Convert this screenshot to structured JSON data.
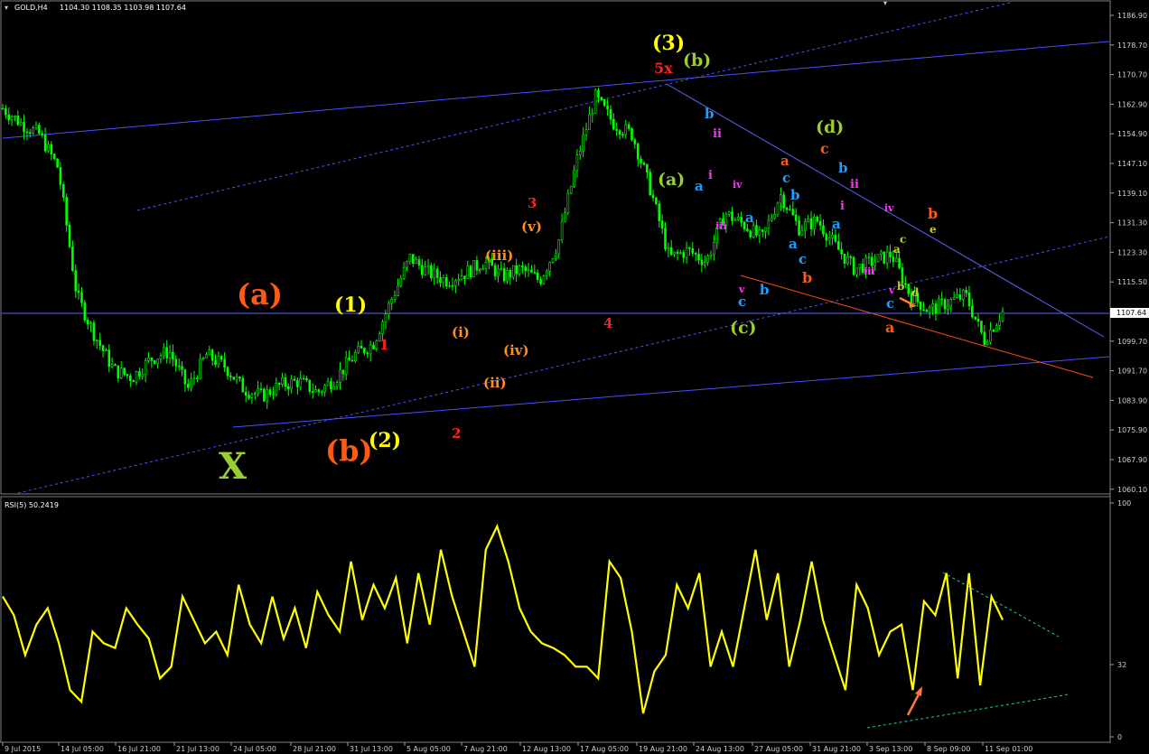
{
  "header": {
    "main_title": "GOLD,H4",
    "ohlc": "1104.30 1108.35 1103.98 1107.64",
    "rsi_title": "RSI(5) 50.2419"
  },
  "current_price": "1107.64",
  "price_axis_labels": [
    "1186.90",
    "1178.70",
    "1170.70",
    "1162.90",
    "1154.90",
    "1147.10",
    "1139.10",
    "1131.30",
    "1123.30",
    "1115.50",
    "1107.60",
    "1099.70",
    "1091.70",
    "1083.90",
    "1075.90",
    "1067.90",
    "1060.10"
  ],
  "rsi_axis_labels": [
    "100",
    "32",
    "0"
  ],
  "time_labels": [
    "9 Jul 2015",
    "14 Jul 05:00",
    "16 Jul 21:00",
    "21 Jul 13:00",
    "24 Jul 05:00",
    "28 Jul 21:00",
    "31 Jul 13:00",
    "5 Aug 05:00",
    "7 Aug 21:00",
    "12 Aug 13:00",
    "17 Aug 05:00",
    "19 Aug 21:00",
    "24 Aug 13:00",
    "27 Aug 05:00",
    "31 Aug 21:00",
    "3 Sep 13:00",
    "8 Sep 09:00",
    "11 Sep 01:00"
  ],
  "wave_labels": [
    {
      "text": "(a)",
      "color": "#ff5a14"
    },
    {
      "text": "(b)",
      "color": "#ff5a14"
    },
    {
      "text": "X",
      "color": "#9acd32"
    },
    {
      "text": "(1)",
      "color": "#ffff00"
    },
    {
      "text": "(2)",
      "color": "#ffff00"
    },
    {
      "text": "(3)",
      "color": "#ffff00"
    },
    {
      "text": "1",
      "color": "#ff2020"
    },
    {
      "text": "2",
      "color": "#ff2020"
    },
    {
      "text": "3",
      "color": "#ff2020"
    },
    {
      "text": "4",
      "color": "#ff2020"
    },
    {
      "text": "5x",
      "color": "#ff2020"
    },
    {
      "text": "(i)",
      "color": "#ff9020"
    },
    {
      "text": "(ii)",
      "color": "#ff9020"
    },
    {
      "text": "(iii)",
      "color": "#ff9020"
    },
    {
      "text": "(iv)",
      "color": "#ff9020"
    },
    {
      "text": "(v)",
      "color": "#ff9020"
    },
    {
      "text": "(a)",
      "color": "#9acd32"
    },
    {
      "text": "(b)",
      "color": "#9acd32"
    },
    {
      "text": "(c)",
      "color": "#9acd32"
    },
    {
      "text": "(d)",
      "color": "#9acd32"
    },
    {
      "text": "b",
      "color": "#1ea0ff"
    },
    {
      "text": "ii",
      "color": "#ff30ff"
    },
    {
      "text": "i",
      "color": "#ff30ff"
    },
    {
      "text": "iv",
      "color": "#ff30ff"
    },
    {
      "text": "a",
      "color": "#1ea0ff"
    },
    {
      "text": "iii",
      "color": "#ff30ff"
    },
    {
      "text": "a",
      "color": "#1ea0ff"
    },
    {
      "text": "v",
      "color": "#ff30ff"
    },
    {
      "text": "c",
      "color": "#1ea0ff"
    },
    {
      "text": "b",
      "color": "#1ea0ff"
    },
    {
      "text": "a",
      "color": "#ff5a14"
    },
    {
      "text": "c",
      "color": "#1ea0ff"
    },
    {
      "text": "b",
      "color": "#1ea0ff"
    },
    {
      "text": "a",
      "color": "#1ea0ff"
    },
    {
      "text": "c",
      "color": "#1ea0ff"
    },
    {
      "text": "b",
      "color": "#ff5a14"
    },
    {
      "text": "c",
      "color": "#ff5a14"
    },
    {
      "text": "b",
      "color": "#1ea0ff"
    },
    {
      "text": "ii",
      "color": "#ff30ff"
    },
    {
      "text": "i",
      "color": "#ff30ff"
    },
    {
      "text": "a",
      "color": "#1ea0ff"
    },
    {
      "text": "iv",
      "color": "#ff30ff"
    },
    {
      "text": "iii",
      "color": "#ff30ff"
    },
    {
      "text": "v",
      "color": "#ff30ff"
    },
    {
      "text": "c",
      "color": "#1ea0ff"
    },
    {
      "text": "a",
      "color": "#ff5a14"
    },
    {
      "text": "b",
      "color": "#ff5a14"
    },
    {
      "text": "e",
      "color": "#c8c832"
    },
    {
      "text": "c",
      "color": "#c8c832"
    },
    {
      "text": "a",
      "color": "#c8c832"
    },
    {
      "text": "b",
      "color": "#c8c832"
    },
    {
      "text": "d",
      "color": "#c8c832"
    }
  ],
  "chart_data": [
    {
      "type": "candlestick",
      "title": "GOLD,H4",
      "ylim": [
        1060.1,
        1190.0
      ],
      "x": [
        "9 Jul 2015",
        "14 Jul",
        "16 Jul",
        "21 Jul",
        "24 Jul",
        "28 Jul",
        "31 Jul",
        "5 Aug",
        "7 Aug",
        "12 Aug",
        "17 Aug",
        "19 Aug",
        "24 Aug",
        "27 Aug",
        "31 Aug",
        "3 Sep",
        "8 Sep",
        "11 Sep"
      ],
      "close_path": [
        1162,
        1158,
        1155,
        1146,
        1112,
        1101,
        1092,
        1090,
        1095,
        1097,
        1087,
        1096,
        1093,
        1087,
        1085,
        1088,
        1089,
        1086,
        1090,
        1096,
        1099,
        1111,
        1122,
        1118,
        1116,
        1118,
        1121,
        1117,
        1119,
        1116,
        1126,
        1148,
        1165,
        1158,
        1155,
        1140,
        1122,
        1124,
        1121,
        1134,
        1131,
        1127,
        1139,
        1130,
        1132,
        1125,
        1119,
        1121,
        1123,
        1112,
        1108,
        1110,
        1112,
        1100,
        1107.64
      ],
      "last_close": 1107.64,
      "colors": {
        "candles": "#00ff00",
        "background": "#000000",
        "grid": "none"
      }
    },
    {
      "type": "line",
      "title": "RSI(5) 50.2419",
      "ylim": [
        0,
        100
      ],
      "series": [
        {
          "name": "RSI(5)",
          "color": "#ffff00",
          "values": [
            60,
            52,
            35,
            48,
            55,
            40,
            20,
            15,
            45,
            40,
            38,
            55,
            48,
            42,
            25,
            30,
            60,
            50,
            40,
            45,
            35,
            65,
            48,
            40,
            60,
            42,
            55,
            38,
            62,
            52,
            45,
            75,
            50,
            65,
            55,
            68,
            40,
            70,
            48,
            80,
            60,
            45,
            30,
            80,
            90,
            75,
            55,
            45,
            40,
            38,
            35,
            30,
            30,
            25,
            75,
            68,
            45,
            10,
            28,
            35,
            65,
            55,
            70,
            30,
            45,
            30,
            55,
            80,
            50,
            70,
            30,
            50,
            75,
            50,
            35,
            20,
            65,
            55,
            35,
            45,
            48,
            20,
            58,
            52,
            70,
            25,
            70,
            22,
            60,
            50
          ]
        }
      ],
      "last_value": 50.2419
    }
  ]
}
